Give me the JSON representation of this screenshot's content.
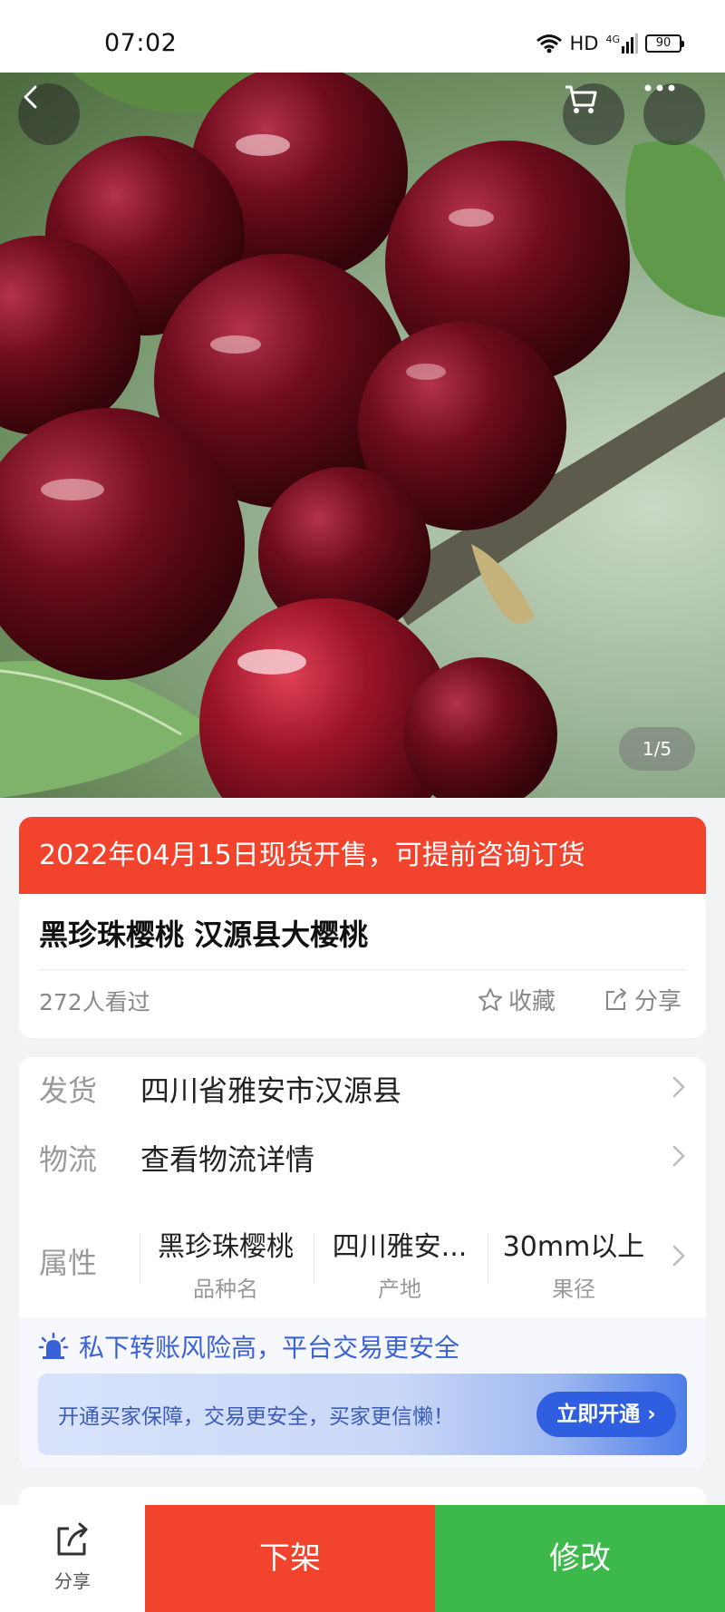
{
  "status_bar": {
    "time": "07:02",
    "network": "HD",
    "signal": "4G",
    "battery": "90"
  },
  "hero": {
    "image_subject": "cherries",
    "counter": "1/5",
    "icons": [
      "chevron-left-icon",
      "cart-icon",
      "more-icon"
    ]
  },
  "product": {
    "presale_notice": "2022年04月15日现货开售，可提前咨询订货",
    "title": "黑珍珠樱桃 汉源县大樱桃",
    "views": "272人看过",
    "favorite_label": "收藏",
    "share_label": "分享"
  },
  "details": {
    "shipping_label": "发货",
    "shipping_value": "四川省雅安市汉源县",
    "logistics_label": "物流",
    "logistics_value": "查看物流详情",
    "attributes_label": "属性",
    "attributes": [
      {
        "value": "黑珍珠樱桃",
        "key": "品种名"
      },
      {
        "value": "四川雅安...",
        "key": "产地"
      },
      {
        "value": "30mm以上",
        "key": "果径"
      }
    ]
  },
  "safety": {
    "tip": "私下转账风险高，平台交易更安全",
    "guarantee_text": "开通买家保障，交易更安全，买家更信懒！",
    "guarantee_button": "立即开通"
  },
  "bottom_bar": {
    "share_label": "分享",
    "unlist_label": "下架",
    "edit_label": "修改"
  },
  "colors": {
    "primary_red": "#f2432c",
    "primary_green": "#3cb94a",
    "link_blue": "#2f5fe0"
  }
}
